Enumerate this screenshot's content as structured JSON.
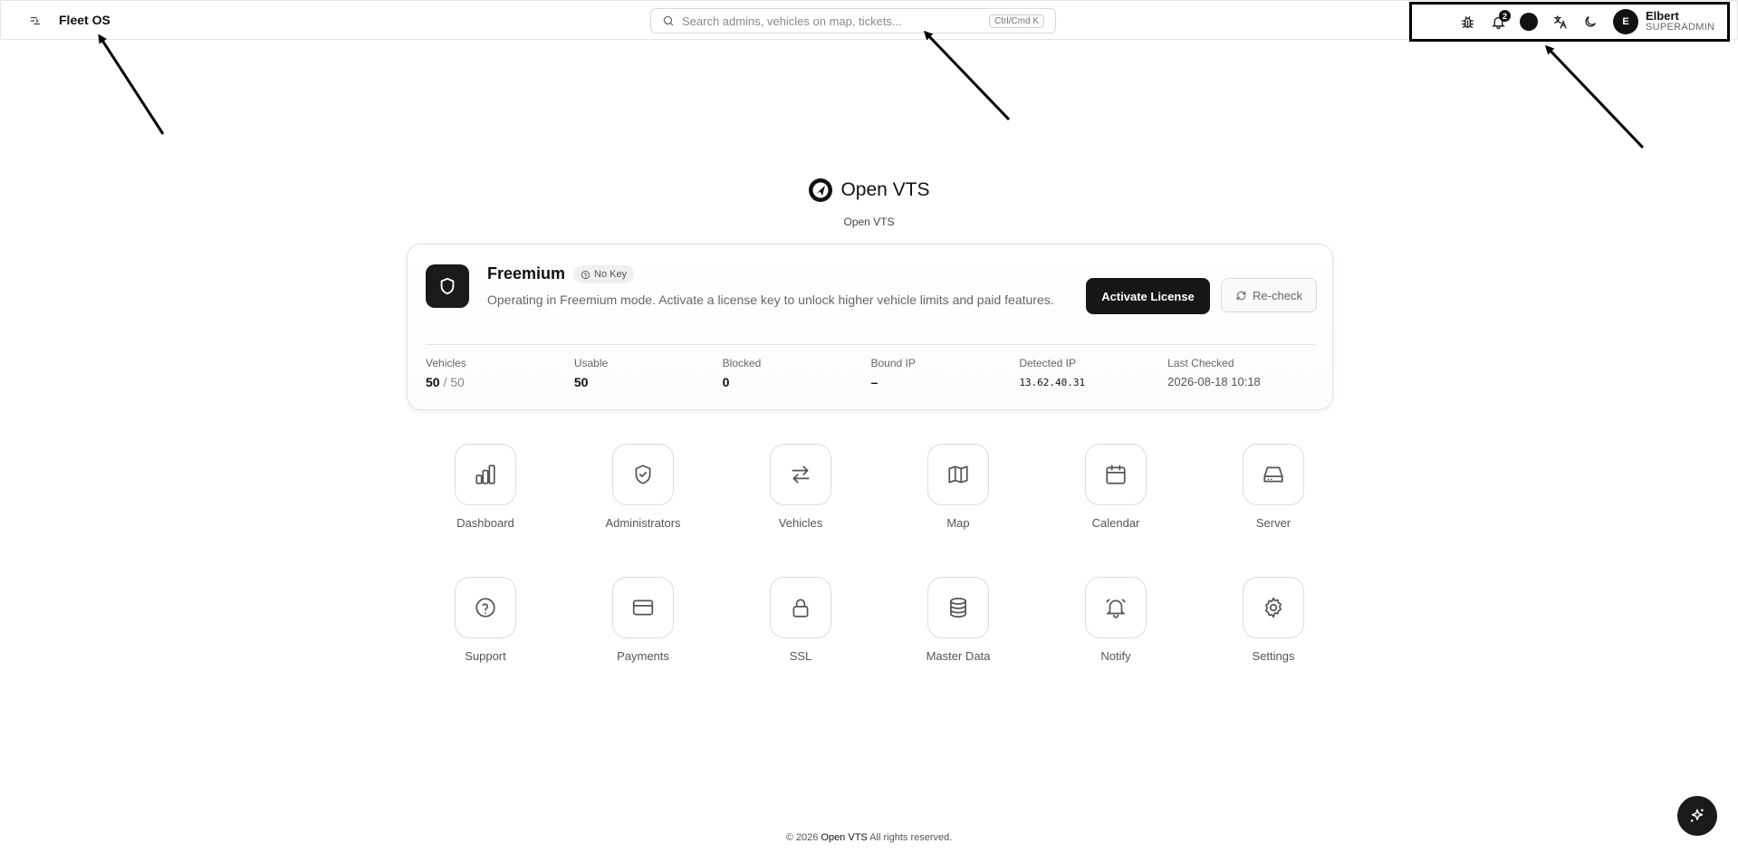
{
  "header": {
    "brand": "Fleet OS",
    "search_placeholder": "Search admins, vehicles on map, tickets...",
    "search_shortcut": "Ctrl/Cmd K",
    "notification_count": "2",
    "user": {
      "initial": "E",
      "name": "Elbert",
      "role": "SUPERADMIN"
    },
    "icons": [
      "sidebar-toggle-icon",
      "bug-icon",
      "bell-icon",
      "theme-color-icon",
      "translate-icon",
      "moon-icon"
    ]
  },
  "hero": {
    "logo_name": "Open VTS",
    "subtitle": "Open VTS"
  },
  "license": {
    "plan": "Freemium",
    "key_status": "No Key",
    "description": "Operating in Freemium mode. Activate a license key to unlock higher vehicle limits and paid features.",
    "activate_label": "Activate License",
    "recheck_label": "Re-check",
    "stats": {
      "vehicles_label": "Vehicles",
      "vehicles_used": "50",
      "vehicles_sep": "/ 50",
      "usable_label": "Usable",
      "usable_value": "50",
      "blocked_label": "Blocked",
      "blocked_value": "0",
      "bound_ip_label": "Bound IP",
      "bound_ip_value": "–",
      "detected_ip_label": "Detected IP",
      "detected_ip_value": "13.62.40.31",
      "last_checked_label": "Last Checked",
      "last_checked_value": "2026-08-18 10:18"
    }
  },
  "apps": [
    {
      "label": "Dashboard",
      "icon": "bar-chart-icon"
    },
    {
      "label": "Administrators",
      "icon": "shield-check-icon"
    },
    {
      "label": "Vehicles",
      "icon": "arrows-exchange-icon"
    },
    {
      "label": "Map",
      "icon": "map-icon"
    },
    {
      "label": "Calendar",
      "icon": "calendar-icon"
    },
    {
      "label": "Server",
      "icon": "hard-drive-icon"
    },
    {
      "label": "Support",
      "icon": "help-circle-icon"
    },
    {
      "label": "Payments",
      "icon": "credit-card-icon"
    },
    {
      "label": "SSL",
      "icon": "lock-icon"
    },
    {
      "label": "Master Data",
      "icon": "database-icon"
    },
    {
      "label": "Notify",
      "icon": "bell-ring-icon"
    },
    {
      "label": "Settings",
      "icon": "gear-icon"
    }
  ],
  "footer": {
    "prefix": "© 2026",
    "brand": "Open VTS",
    "suffix": "All rights reserved."
  },
  "assistant": {
    "icon": "sparkles-icon"
  }
}
